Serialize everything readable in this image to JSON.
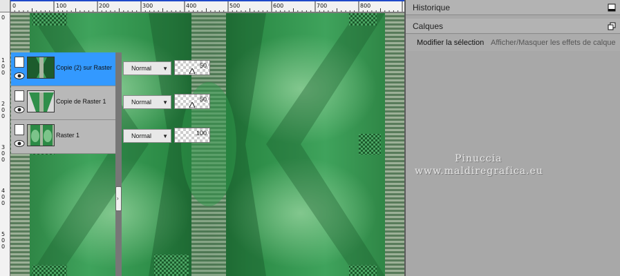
{
  "ruler": {
    "top_labels": [
      "0",
      "100",
      "200",
      "300",
      "400",
      "500",
      "600",
      "700",
      "800"
    ],
    "left_labels": [
      [
        "0"
      ],
      [
        "1",
        "0",
        "0"
      ],
      [
        "2",
        "0",
        "0"
      ],
      [
        "3",
        "0",
        "0"
      ],
      [
        "4",
        "0",
        "0"
      ],
      [
        "5",
        "0",
        "0"
      ]
    ]
  },
  "panels": {
    "history": {
      "title": "Historique",
      "button_icon": "minimize-icon"
    },
    "layers": {
      "title": "Calques",
      "button_icon": "restore-icon",
      "modify_selection": "Modifier la sélection",
      "show_hide_effects": "Afficher/Masquer les effets de calque"
    }
  },
  "layers": [
    {
      "name": "Copie (2) sur Raster",
      "blend": "Normal",
      "opacity": "50",
      "opacity_fraction": 0.5,
      "selected": true
    },
    {
      "name": "Copie de Raster 1",
      "blend": "Normal",
      "opacity": "50",
      "opacity_fraction": 0.5,
      "selected": false
    },
    {
      "name": "Raster 1",
      "blend": "Normal",
      "opacity": "100",
      "opacity_fraction": 1.0,
      "selected": false
    }
  ],
  "watermark": {
    "line1": "Pinuccia",
    "line2": "www.maldiregrafica.eu"
  },
  "colors": {
    "selection": "#3399ff",
    "canvas_green": "#2f8f4a",
    "ruler_blue": "#1f49c9"
  }
}
